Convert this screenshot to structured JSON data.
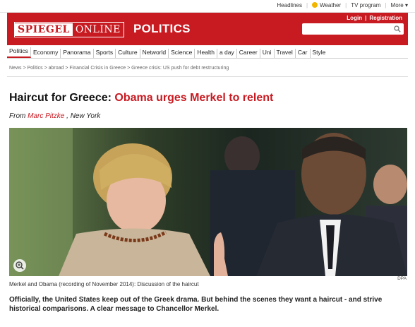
{
  "toplinks": [
    "Headlines",
    "Weather",
    "TV program",
    "More ▾"
  ],
  "header": {
    "logo_left": "SPIEGEL",
    "logo_right": "ONLINE",
    "section": "POLITICS",
    "login": "Login",
    "registration": "Registration",
    "search_placeholder": ""
  },
  "nav": [
    "Politics",
    "Economy",
    "Panorama",
    "Sports",
    "Culture",
    "Networld",
    "Science",
    "Health",
    "a day",
    "Career",
    "Uni",
    "Travel",
    "Car",
    "Style"
  ],
  "breadcrumb": "News > Politics > abroad > Financial Crisis in Greece > Greece crisis: US push for debt restructuring",
  "article": {
    "headline_prefix": "Haircut for Greece:",
    "headline_main": "Obama urges Merkel to relent",
    "byline_from": "From",
    "byline_author": "Marc Pitzke",
    "byline_place": ", New York",
    "caption": "Merkel and Obama (recording of November 2014): Discussion of the haircut",
    "credit": "DPA",
    "teaser": "Officially, the United States keep out of the Greek drama. But behind the scenes they want a haircut - and strive historical comparisons. A clear message to Chancellor Merkel."
  },
  "colors": {
    "brand": "#c81a21"
  },
  "icons": {
    "search": "search-icon",
    "zoom": "zoom-icon",
    "weather": "sun-icon"
  }
}
